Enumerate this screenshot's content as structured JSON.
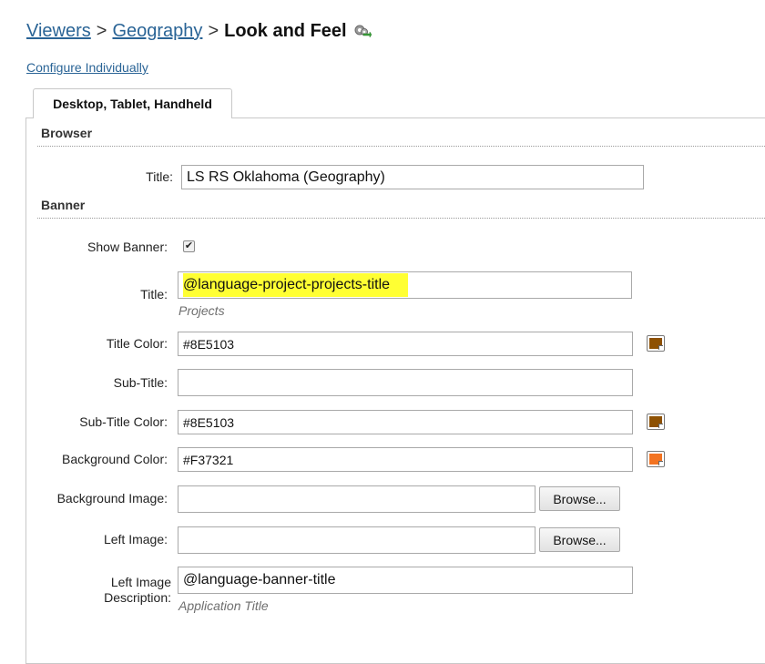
{
  "breadcrumb": {
    "items": [
      "Viewers",
      "Geography"
    ],
    "separator": ">",
    "current": "Look and Feel",
    "icon": "gears-arrow-icon"
  },
  "configure_link": "Configure Individually",
  "tab": {
    "label": "Desktop, Tablet, Handheld"
  },
  "browser": {
    "section_title": "Browser",
    "title_label": "Title:",
    "title_value": "LS RS Oklahoma (Geography)"
  },
  "banner": {
    "section_title": "Banner",
    "show_banner_label": "Show Banner:",
    "show_banner_checked": true,
    "title_label": "Title:",
    "title_value": "@language-project-projects-title",
    "title_hint": "Projects",
    "title_color_label": "Title Color:",
    "title_color_value": "#8E5103",
    "subtitle_label": "Sub-Title:",
    "subtitle_value": "",
    "subtitle_color_label": "Sub-Title Color:",
    "subtitle_color_value": "#8E5103",
    "background_color_label": "Background Color:",
    "background_color_value": "#F37321",
    "background_image_label": "Background Image:",
    "background_image_value": "",
    "left_image_label": "Left Image:",
    "left_image_value": "",
    "browse_label": "Browse...",
    "left_image_desc_label_line1": "Left Image",
    "left_image_desc_label_line2": "Description:",
    "left_image_desc_value": "@language-banner-title",
    "left_image_desc_hint": "Application Title"
  },
  "colors": {
    "link": "#2A6496",
    "highlight": "#FFFF33",
    "title_swatch": "#8E5103",
    "subtitle_swatch": "#8E5103",
    "background_swatch": "#F37321"
  }
}
